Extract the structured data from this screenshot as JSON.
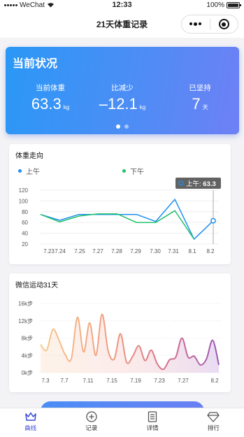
{
  "status_bar": {
    "carrier": "WeChat",
    "time": "12:33",
    "battery": "100%"
  },
  "nav": {
    "title": "21天体重记录"
  },
  "status_card": {
    "title": "当前状况",
    "stats": [
      {
        "label": "当前体重",
        "value": "63.3",
        "unit": "kg"
      },
      {
        "label": "比减少",
        "value": "–12.1",
        "unit": "kg"
      },
      {
        "label": "已坚持",
        "value": "7",
        "unit": "天"
      }
    ],
    "page_count": 2,
    "active_page": 0
  },
  "weight_chart": {
    "title": "体重走向",
    "tooltip": {
      "label": "上午:",
      "value": "63.3"
    }
  },
  "steps_chart": {
    "title": "微信运动31天"
  },
  "chart_data": [
    {
      "type": "line",
      "title": "体重走向",
      "categories": [
        "7.23",
        "7.24",
        "7.25",
        "7.27",
        "7.28",
        "7.29",
        "7.30",
        "7.31",
        "8.1",
        "8.2"
      ],
      "ylim": [
        20,
        120
      ],
      "yticks": [
        20,
        40,
        60,
        80,
        100,
        120
      ],
      "legend_position": "top",
      "grid": "horizontal",
      "series": [
        {
          "name": "上午",
          "color": "#1e8ff0",
          "values": [
            75,
            64,
            75,
            75,
            75,
            75,
            62,
            103,
            29,
            63.3
          ]
        },
        {
          "name": "下午",
          "color": "#22c16b",
          "values": [
            75,
            61,
            72,
            76,
            76,
            60,
            60,
            82,
            29,
            null
          ]
        }
      ]
    },
    {
      "type": "area",
      "title": "微信运动31天",
      "x_tick_labels": [
        "7.3",
        "7.7",
        "7.11",
        "7.15",
        "7.19",
        "7.23",
        "7.27",
        "8.2"
      ],
      "ytick_labels": [
        "0k步",
        "4k步",
        "8k步",
        "12k步",
        "16k步"
      ],
      "ylim": [
        0,
        16000
      ],
      "grid": "horizontal",
      "series": [
        {
          "values": [
            6500,
            5200,
            10000,
            7500,
            4200,
            3200,
            12800,
            4800,
            11500,
            4000,
            13500,
            5000,
            3200,
            9000,
            2400,
            3800,
            6200,
            2800,
            5200,
            2000,
            800,
            3000,
            3600,
            8000,
            3600,
            3800,
            1800,
            3200,
            7500,
            1800
          ]
        }
      ]
    }
  ],
  "tabs": [
    {
      "label": "曲线",
      "icon": "crown-icon",
      "active": true
    },
    {
      "label": "记录",
      "icon": "add-circle-icon",
      "active": false
    },
    {
      "label": "详情",
      "icon": "document-icon",
      "active": false
    },
    {
      "label": "排行",
      "icon": "diamond-icon",
      "active": false
    }
  ],
  "colors": {
    "accent": "#3b4ad6",
    "card_start": "#2a98f6",
    "card_end": "#6e80f5"
  }
}
